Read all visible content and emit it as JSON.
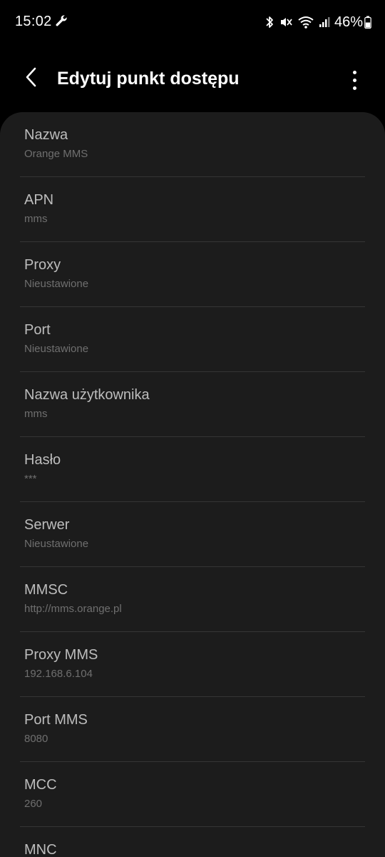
{
  "status_bar": {
    "time": "15:02",
    "battery_percent": "46%",
    "icons": [
      "wrench-icon",
      "bluetooth-icon",
      "mute-vibrate-icon",
      "wifi-icon",
      "signal-icon",
      "battery-icon"
    ]
  },
  "header": {
    "title": "Edytuj punkt dostępu"
  },
  "fields": [
    {
      "title": "Nazwa",
      "value": "Orange MMS"
    },
    {
      "title": "APN",
      "value": "mms"
    },
    {
      "title": "Proxy",
      "value": "Nieustawione"
    },
    {
      "title": "Port",
      "value": "Nieustawione"
    },
    {
      "title": "Nazwa użytkownika",
      "value": "mms"
    },
    {
      "title": "Hasło",
      "value": "***"
    },
    {
      "title": "Serwer",
      "value": "Nieustawione"
    },
    {
      "title": "MMSC",
      "value": "http://mms.orange.pl"
    },
    {
      "title": "Proxy MMS",
      "value": "192.168.6.104"
    },
    {
      "title": "Port MMS",
      "value": "8080"
    },
    {
      "title": "MCC",
      "value": "260"
    },
    {
      "title": "MNC",
      "value": ""
    }
  ],
  "colors": {
    "background": "#000000",
    "card": "#1c1c1c",
    "title_text": "#bdbdbd",
    "value_text": "#6f6f6f",
    "divider": "#353535"
  }
}
